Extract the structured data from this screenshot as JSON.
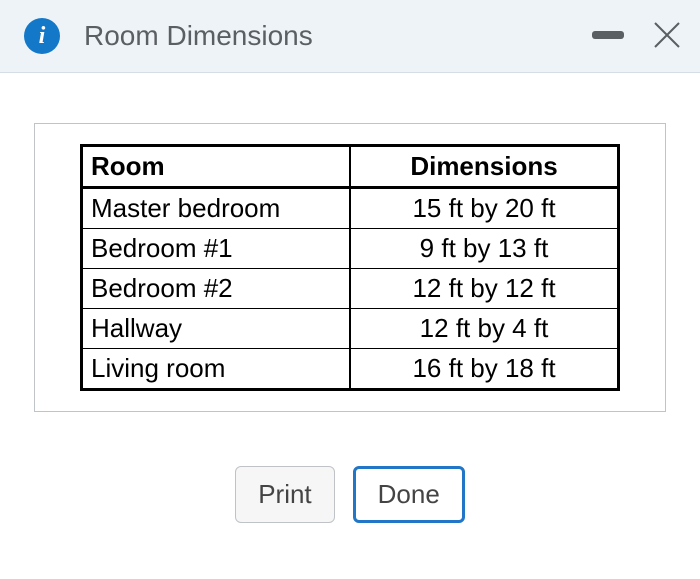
{
  "dialog": {
    "title": "Room Dimensions"
  },
  "table": {
    "headers": {
      "room": "Room",
      "dimensions": "Dimensions"
    },
    "rows": [
      {
        "room": "Master bedroom",
        "dimensions": "15 ft by 20 ft"
      },
      {
        "room": "Bedroom #1",
        "dimensions": "9 ft by 13 ft"
      },
      {
        "room": "Bedroom #2",
        "dimensions": "12 ft by 12 ft"
      },
      {
        "room": "Hallway",
        "dimensions": "12 ft by 4 ft"
      },
      {
        "room": "Living room",
        "dimensions": "16 ft by 18 ft"
      }
    ]
  },
  "buttons": {
    "print": "Print",
    "done": "Done"
  }
}
